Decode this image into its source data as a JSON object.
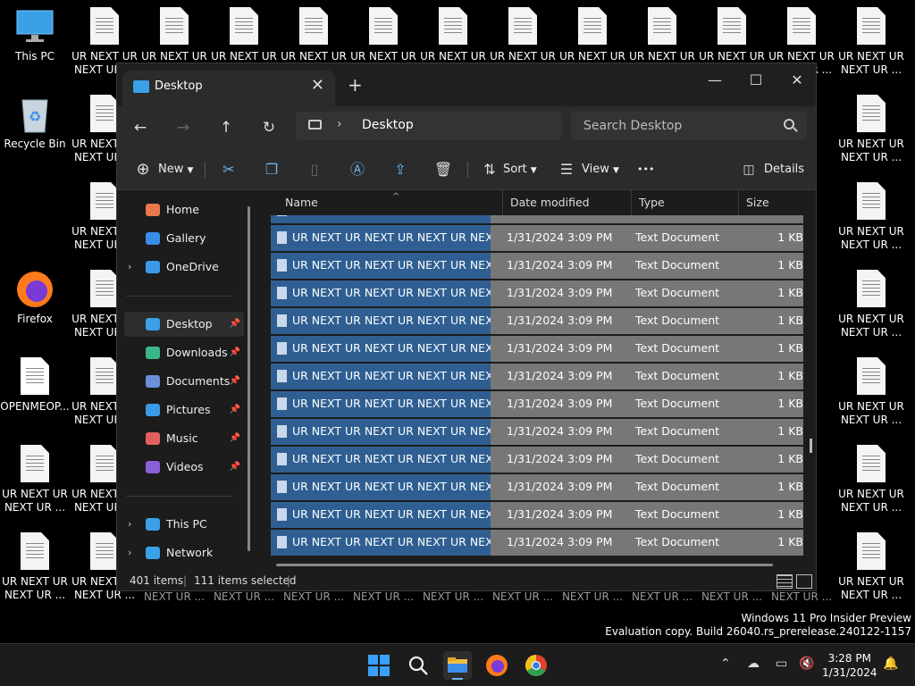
{
  "desktop": {
    "icons": [
      {
        "label": "This PC",
        "kind": "pc",
        "col": 0,
        "row": 0
      },
      {
        "label": "Recycle Bin",
        "kind": "bin",
        "col": 0,
        "row": 1
      },
      {
        "label": "Firefox",
        "kind": "firefox",
        "col": 0,
        "row": 3
      },
      {
        "label": "OPENMEOP...",
        "kind": "doc-plain",
        "col": 0,
        "row": 4
      },
      {
        "label": "UR NEXT UR NEXT UR ...",
        "kind": "doc",
        "col": 0,
        "row": 5
      },
      {
        "label": "UR NEXT UR NEXT UR ...",
        "kind": "doc",
        "col": 0,
        "row": 6
      }
    ],
    "top_row_label": "UR NEXT UR NEXT UR ...",
    "right_col_label": "UR NEXT UR NEXT UR ...",
    "bottom_strip_label": "NEXT UR ...",
    "watermark_line1": "Windows 11 Pro Insider Preview",
    "watermark_line2": "Evaluation copy. Build 26040.rs_prerelease.240122-1157"
  },
  "window": {
    "tab_title": "Desktop",
    "tab_close": "✕",
    "new_tab": "+",
    "minimize": "—",
    "maximize": "☐",
    "close": "✕",
    "nav": {
      "back": "←",
      "forward": "→",
      "up": "↑",
      "refresh": "↻"
    },
    "address": {
      "chevron": "›",
      "crumb": "Desktop"
    },
    "search_placeholder": "Search Desktop",
    "toolbar": {
      "new_label": "New",
      "sort_label": "Sort",
      "view_label": "View",
      "more_label": "•••",
      "details_label": "Details"
    },
    "sidebar": {
      "items": [
        {
          "label": "Home",
          "icon": "home-icon",
          "color": "#e8774a",
          "expand": "",
          "pinned": false,
          "active": false
        },
        {
          "label": "Gallery",
          "icon": "gallery-icon",
          "color": "#3a8ee8",
          "expand": "",
          "pinned": false,
          "active": false
        },
        {
          "label": "OneDrive",
          "icon": "cloud-icon",
          "color": "#3a9ae8",
          "expand": "›",
          "pinned": false,
          "active": false
        },
        {
          "label": "Desktop",
          "icon": "desktop-icon",
          "color": "#3aa0e8",
          "expand": "",
          "pinned": true,
          "active": true
        },
        {
          "label": "Downloads",
          "icon": "download-icon",
          "color": "#3ab88a",
          "expand": "",
          "pinned": true,
          "active": false
        },
        {
          "label": "Documents",
          "icon": "documents-icon",
          "color": "#6c8fd8",
          "expand": "",
          "pinned": true,
          "active": false
        },
        {
          "label": "Pictures",
          "icon": "pictures-icon",
          "color": "#3a9ae8",
          "expand": "",
          "pinned": true,
          "active": false
        },
        {
          "label": "Music",
          "icon": "music-icon",
          "color": "#e06060",
          "expand": "",
          "pinned": true,
          "active": false
        },
        {
          "label": "Videos",
          "icon": "videos-icon",
          "color": "#8a60d8",
          "expand": "",
          "pinned": true,
          "active": false
        },
        {
          "label": "This PC",
          "icon": "pc-icon",
          "color": "#3aa0e8",
          "expand": "›",
          "pinned": false,
          "active": false
        },
        {
          "label": "Network",
          "icon": "network-icon",
          "color": "#3aa0e8",
          "expand": "›",
          "pinned": false,
          "active": false
        }
      ],
      "pin_glyph": "📌"
    },
    "columns": {
      "name": "Name",
      "date": "Date modified",
      "type": "Type",
      "size": "Size"
    },
    "file_name": "UR NEXT UR NEXT UR NEXT UR NEXT UR...",
    "file_date": "1/31/2024 3:09 PM",
    "file_type": "Text Document",
    "file_size": "1 KB",
    "visible_row_count": 13,
    "status": {
      "items": "401 items",
      "selected": "111 items selected"
    }
  },
  "taskbar": {
    "time": "3:28 PM",
    "date": "1/31/2024",
    "tray_chevron": "⌃"
  },
  "colors": {
    "selection_name": "#2f5f92",
    "selection_row": "#777777",
    "accent": "#3aa0e8"
  }
}
